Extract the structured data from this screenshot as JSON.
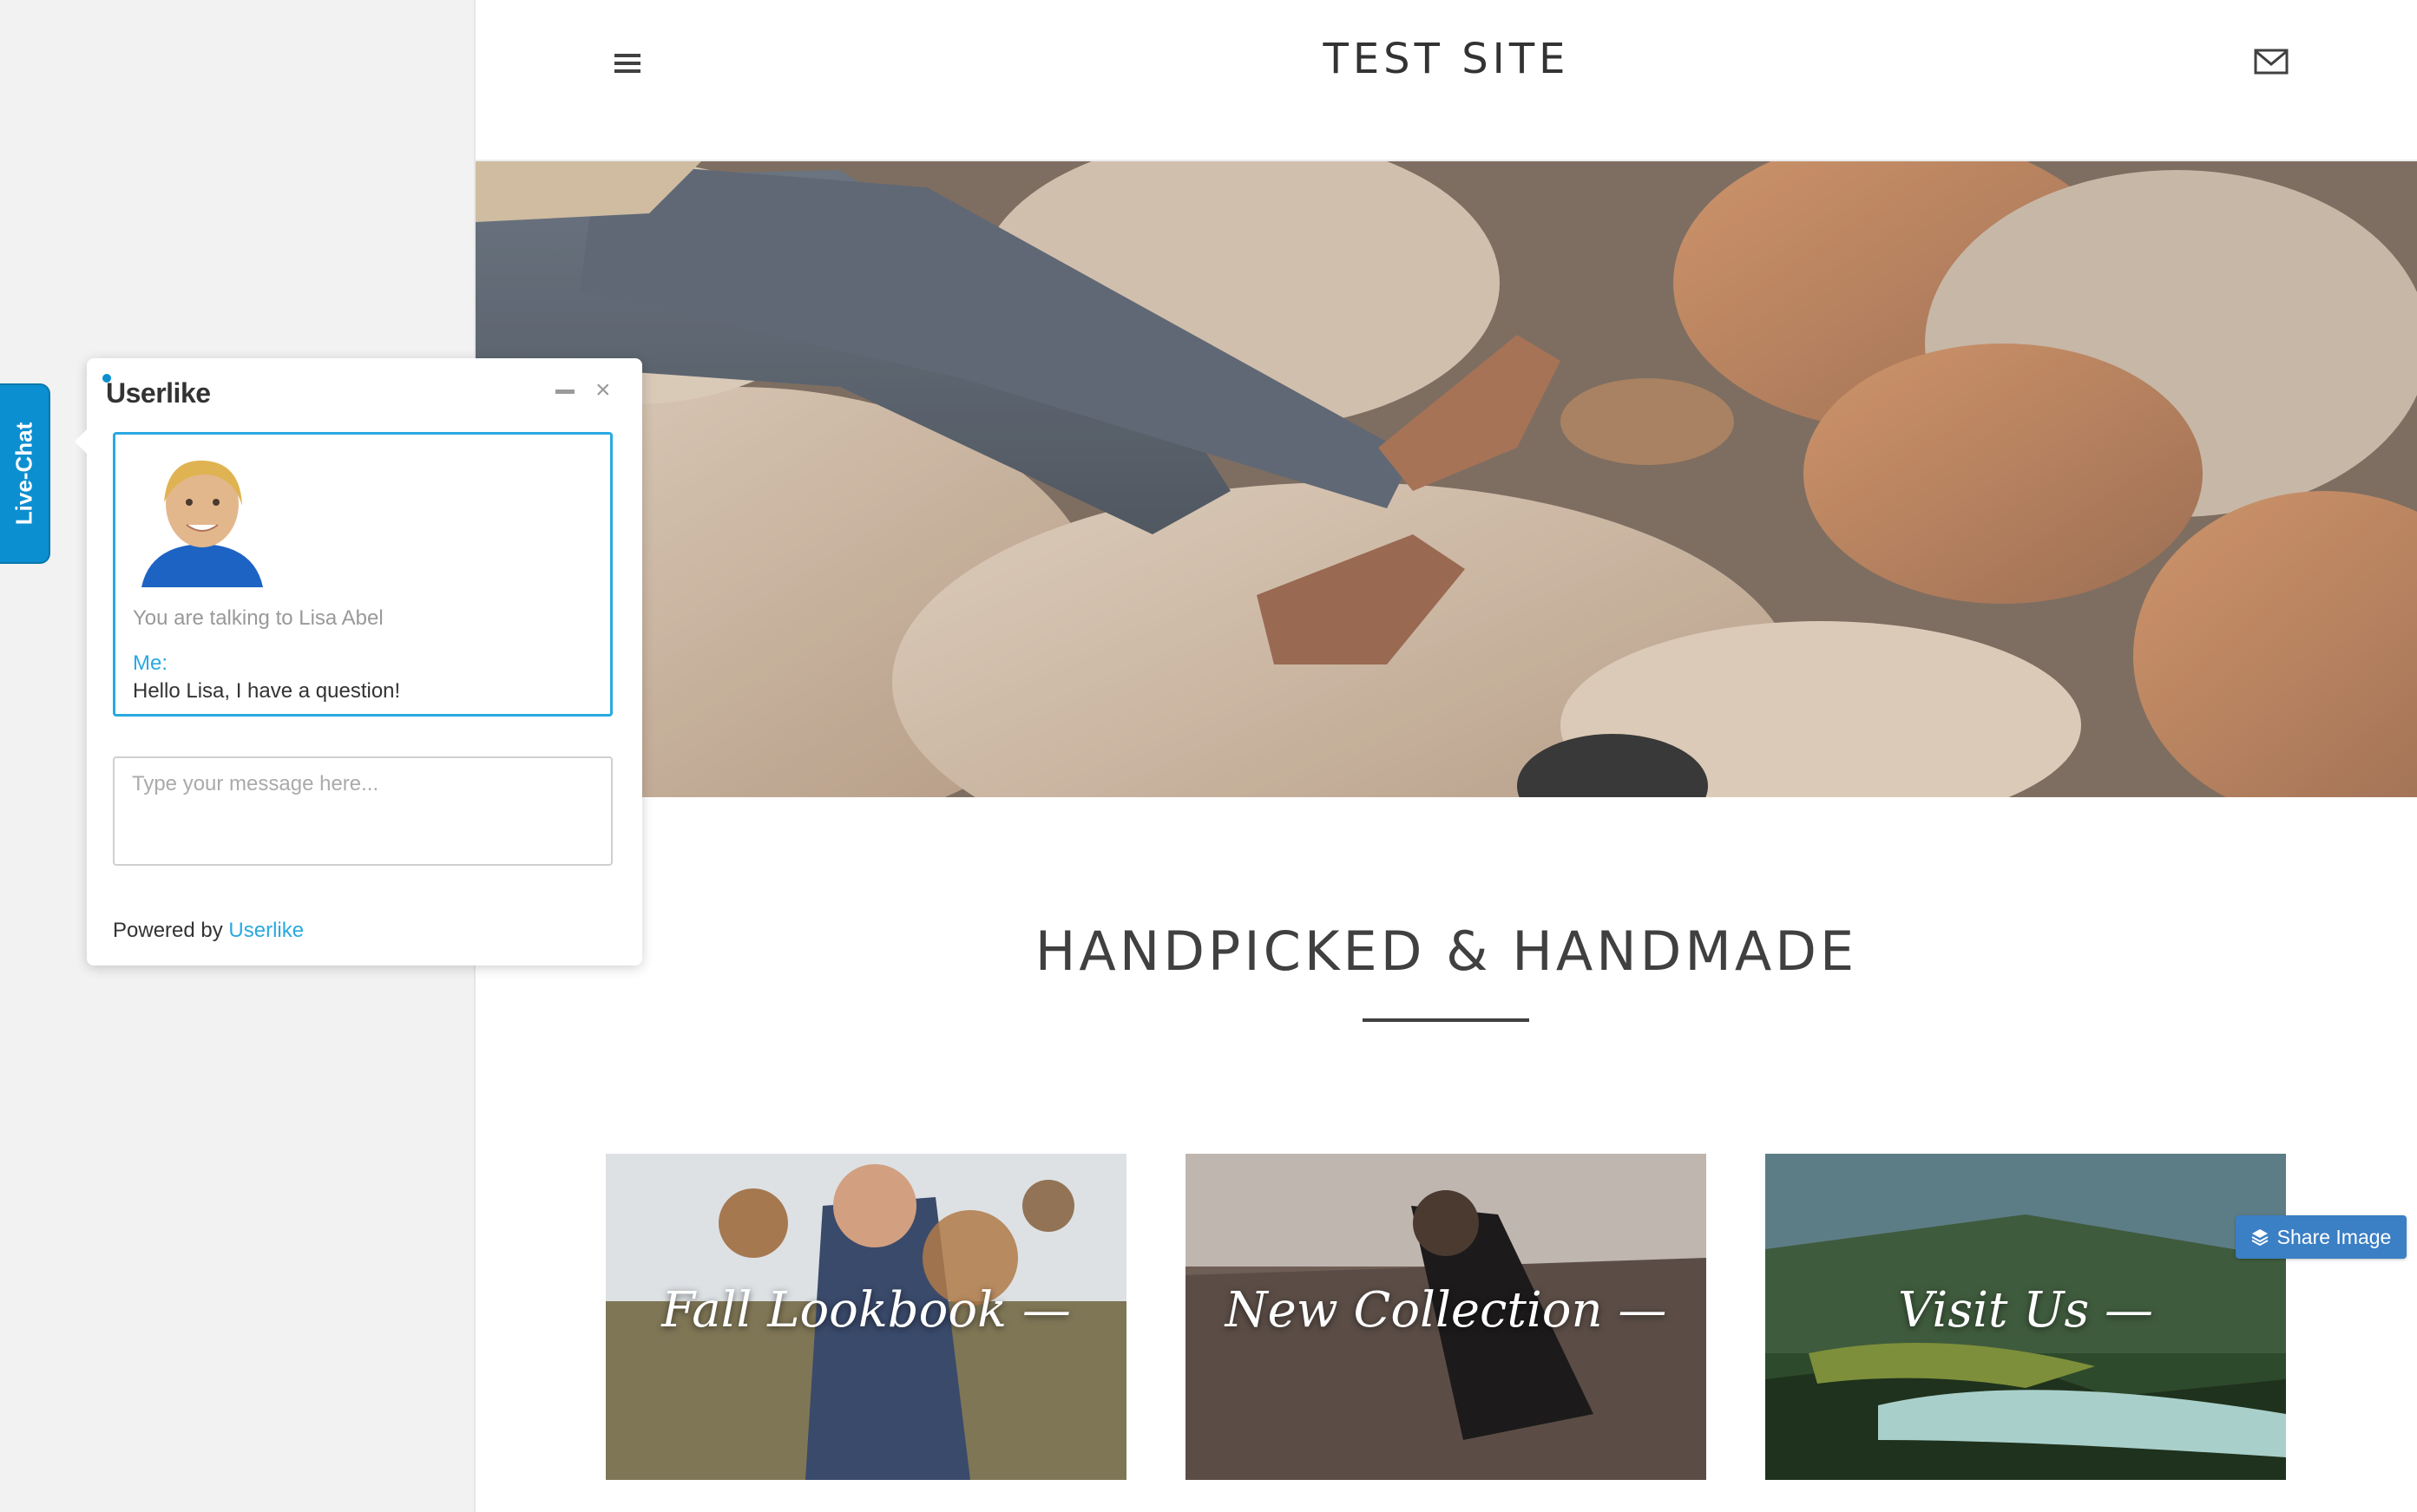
{
  "header": {
    "title": "TEST SITE"
  },
  "hero": {
    "icon": "hero-image"
  },
  "section": {
    "heading": "HANDPICKED & HANDMADE"
  },
  "cards": [
    {
      "label": "Fall Lookbook —"
    },
    {
      "label": "New Collection —"
    },
    {
      "label": "Visit Us —"
    }
  ],
  "share": {
    "label": "Share Image",
    "icon": "layers-icon"
  },
  "livechat": {
    "tab_label": "Live-Chat",
    "brand": "Userlike",
    "status": "You are talking to Lisa Abel",
    "me_label": "Me:",
    "message": "Hello Lisa, I have a question!",
    "input_placeholder": "Type your message here...",
    "powered_prefix": "Powered by",
    "powered_link": "Userlike"
  },
  "colors": {
    "accent": "#29a9e1",
    "tab": "#0c8fd0",
    "share": "#3b7fc4",
    "text": "#404040"
  }
}
